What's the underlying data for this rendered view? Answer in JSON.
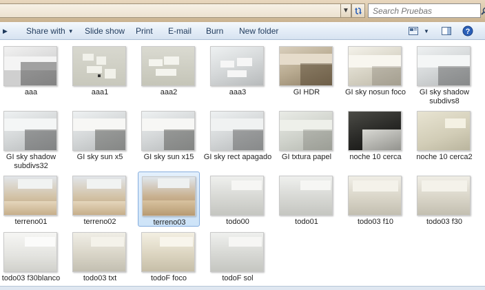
{
  "search": {
    "placeholder": "Search Pruebas"
  },
  "toolbar": {
    "share_with": "Share with",
    "slide_show": "Slide show",
    "print": "Print",
    "email": "E-mail",
    "burn": "Burn",
    "new_folder": "New folder"
  },
  "icons": {
    "search": "search-icon",
    "refresh": "refresh-icon",
    "views": "views-icon",
    "preview_pane": "preview-pane-icon",
    "help": "help-icon"
  },
  "colors": {
    "toolbar_text": "#1e395b",
    "selection_border": "#84acdd",
    "help_blue": "#2a5fb8"
  },
  "files": [
    {
      "name": "aaa"
    },
    {
      "name": "aaa1"
    },
    {
      "name": "aaa2"
    },
    {
      "name": "aaa3"
    },
    {
      "name": "GI HDR"
    },
    {
      "name": "GI sky  nosun foco"
    },
    {
      "name": "GI sky  shadow subdivs8"
    },
    {
      "name": "GI sky  shadow subdivs32"
    },
    {
      "name": "GI sky  sun x5"
    },
    {
      "name": "GI sky  sun x15"
    },
    {
      "name": "GI sky rect apagado"
    },
    {
      "name": "GI txtura papel"
    },
    {
      "name": "noche 10 cerca"
    },
    {
      "name": "noche 10 cerca2"
    },
    {
      "name": "terreno01"
    },
    {
      "name": "terreno02"
    },
    {
      "name": "terreno03",
      "selected": true
    },
    {
      "name": "todo00"
    },
    {
      "name": "todo01"
    },
    {
      "name": "todo03 f10"
    },
    {
      "name": "todo03 f30"
    },
    {
      "name": "todo03 f30blanco"
    },
    {
      "name": "todo03 txt"
    },
    {
      "name": "todoF foco"
    },
    {
      "name": "todoF sol"
    }
  ]
}
